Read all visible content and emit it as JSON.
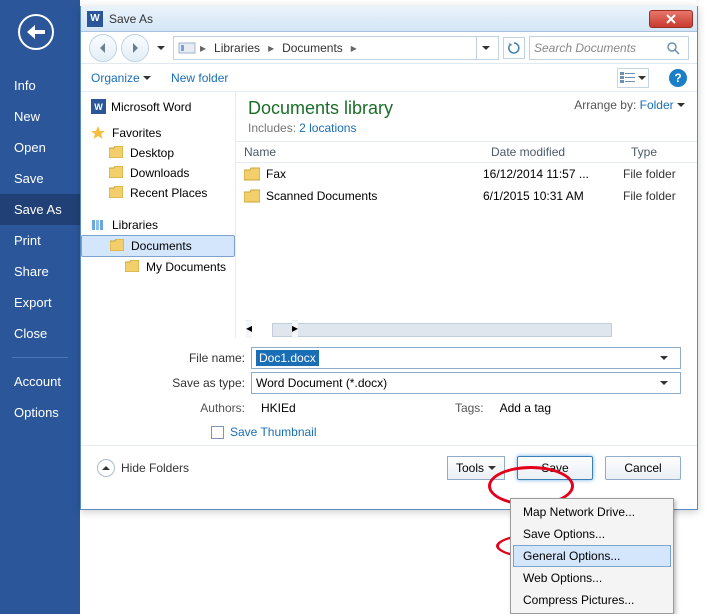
{
  "word_sidebar": {
    "items": [
      "Info",
      "New",
      "Open",
      "Save",
      "Save As",
      "Print",
      "Share",
      "Export",
      "Close"
    ],
    "lower_items": [
      "Account",
      "Options"
    ],
    "selected_index": 4
  },
  "dialog": {
    "title": "Save As",
    "breadcrumb": [
      "Libraries",
      "Documents"
    ],
    "search_placeholder": "Search Documents",
    "organize": "Organize",
    "new_folder": "New folder",
    "help_tooltip": "?",
    "tree": {
      "word_app": "Microsoft Word",
      "favorites": "Favorites",
      "fav_items": [
        "Desktop",
        "Downloads",
        "Recent Places"
      ],
      "libraries": "Libraries",
      "lib_items": [
        "Documents",
        "My Documents"
      ]
    },
    "library": {
      "title": "Documents library",
      "includes": "Includes:",
      "locations": "2 locations",
      "arrange_by_label": "Arrange by:",
      "arrange_by_value": "Folder"
    },
    "columns": {
      "name": "Name",
      "date": "Date modified",
      "type": "Type"
    },
    "rows": [
      {
        "name": "Fax",
        "date": "16/12/2014 11:57 ...",
        "type": "File folder"
      },
      {
        "name": "Scanned Documents",
        "date": "6/1/2015 10:31 AM",
        "type": "File folder"
      }
    ],
    "file_name_label": "File name:",
    "file_name_value": "Doc1.docx",
    "save_type_label": "Save as type:",
    "save_type_value": "Word Document (*.docx)",
    "authors_label": "Authors:",
    "authors_value": "HKIEd",
    "tags_label": "Tags:",
    "tags_value": "Add a tag",
    "save_thumbnail": "Save Thumbnail",
    "hide_folders": "Hide Folders",
    "tools_label": "Tools",
    "save_button": "Save",
    "cancel_button": "Cancel"
  },
  "tools_menu": {
    "items": [
      "Map Network Drive...",
      "Save Options...",
      "General Options...",
      "Web Options...",
      "Compress Pictures..."
    ],
    "hover_index": 2
  }
}
